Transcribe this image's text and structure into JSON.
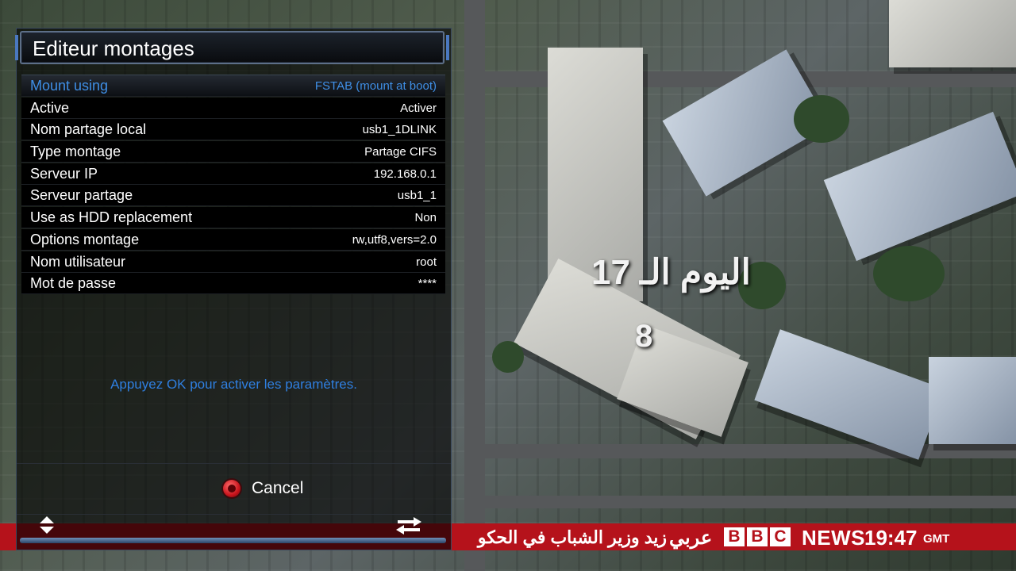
{
  "background": {
    "overlay_arabic": "اليوم الـ 17",
    "overlay_number": "8"
  },
  "ticker": {
    "headline": "زيد وزير الشباب في الحكو",
    "arabic_tag": "عربي",
    "bbc_letters": [
      "B",
      "B",
      "C"
    ],
    "news_label": "NEWS",
    "time": "19:47",
    "tz": "GMT",
    "color": "#b5121b"
  },
  "dialog": {
    "title": "Editeur montages",
    "rows": [
      {
        "label": "Mount using",
        "value": "FSTAB (mount at boot)",
        "selected": true
      },
      {
        "label": "Active",
        "value": "Activer"
      },
      {
        "label": "Nom partage local",
        "value": "usb1_1DLINK"
      },
      {
        "label": "Type montage",
        "value": "Partage CIFS"
      },
      {
        "label": "Serveur IP",
        "value": "192.168.0.1"
      },
      {
        "label": "Serveur partage",
        "value": "usb1_1"
      },
      {
        "label": "Use as HDD replacement",
        "value": "Non"
      },
      {
        "label": "Options montage",
        "value": "rw,utf8,vers=2.0"
      },
      {
        "label": "Nom utilisateur",
        "value": "root"
      },
      {
        "label": "Mot de passe",
        "value": "****"
      }
    ],
    "help_text": "Appuyez OK pour activer les paramètres.",
    "cancel_label": "Cancel",
    "nav_updown_icon": "updown-arrows-icon",
    "nav_leftright_icon": "leftright-arrows-icon",
    "accent_color": "#3f8fe6"
  }
}
